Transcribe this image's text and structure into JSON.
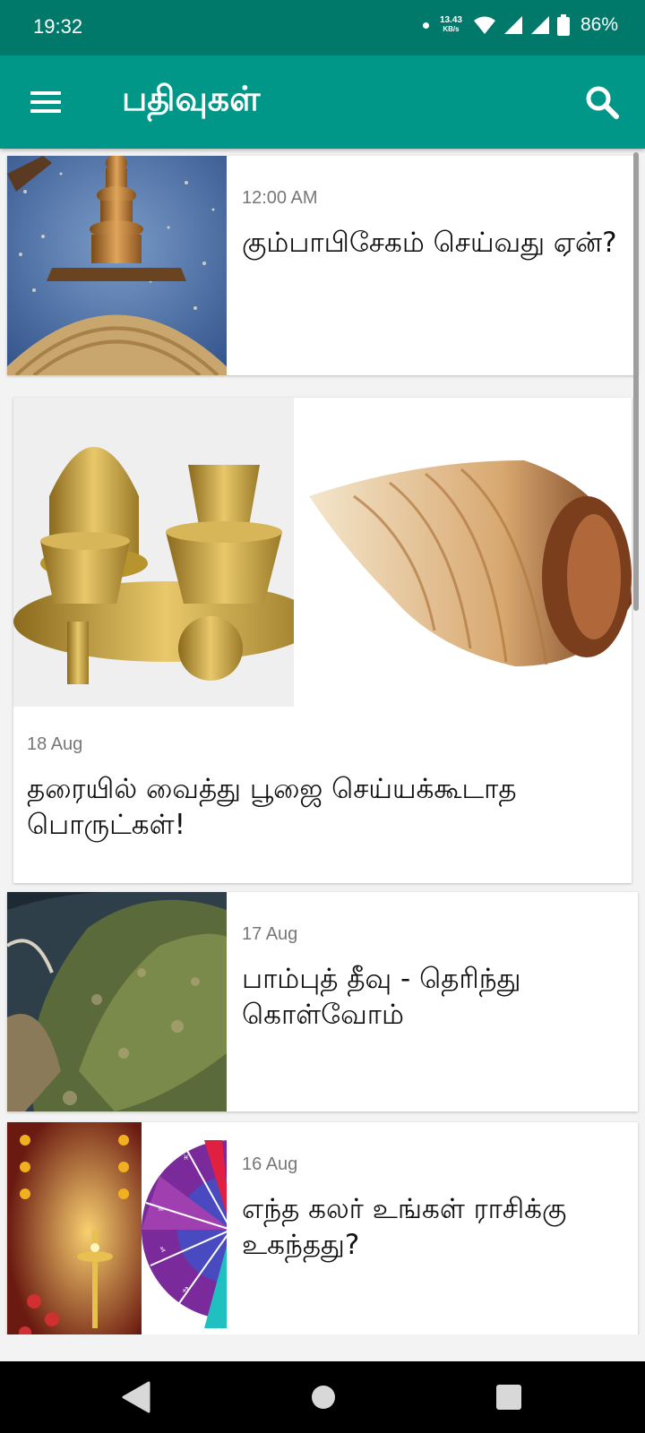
{
  "status_bar": {
    "time": "19:32",
    "speed_value": "13.43",
    "speed_unit": "KB/s",
    "battery": "86%",
    "icons": [
      "dot-icon",
      "wifi-icon",
      "signal-icon",
      "signal-icon",
      "battery-icon"
    ]
  },
  "app_bar": {
    "title": "பதிவுகள்",
    "menu_icon": "hamburger-menu-icon",
    "search_icon": "search-icon",
    "color": "#009688",
    "status_color": "#00796b"
  },
  "posts": [
    {
      "date": "12:00 AM",
      "title": "கும்பாபிசேகம் செய்வது ஏன்?"
    },
    {
      "date": "18 Aug",
      "title": "தரையில் வைத்து பூஜை செய்யக்கூடாத பொருட்கள்!"
    },
    {
      "date": "17 Aug",
      "title": "பாம்புத் தீவு - தெரிந்து கொள்வோம்"
    },
    {
      "date": "16 Aug",
      "title": "எந்த கலர் உங்கள் ராசிக்கு உகந்தது?"
    }
  ],
  "nav_bar": {
    "icons": [
      "back-icon",
      "home-icon",
      "recents-icon"
    ]
  }
}
